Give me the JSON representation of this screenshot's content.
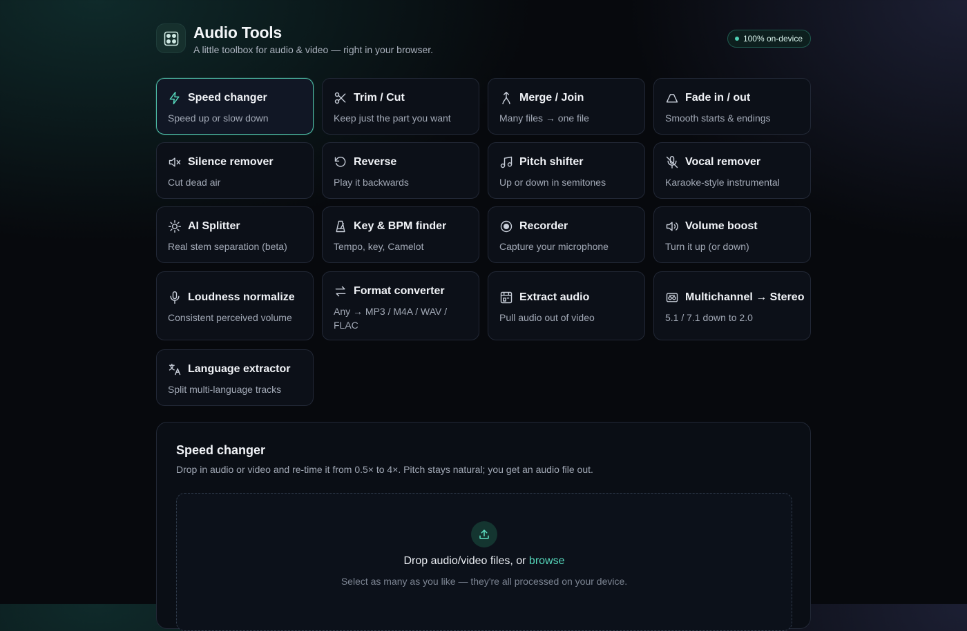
{
  "header": {
    "title": "Audio Tools",
    "subtitle": "A little toolbox for audio & video — right in your browser.",
    "badge": "100% on-device",
    "logo_icon": "mixer-knobs-icon"
  },
  "accent": "#56d6bb",
  "tools": [
    {
      "name": "Speed changer",
      "desc": "Speed up or slow down",
      "icon": "lightning-icon",
      "active": true
    },
    {
      "name": "Trim / Cut",
      "desc": "Keep just the part you want",
      "icon": "scissors-icon"
    },
    {
      "name": "Merge / Join",
      "desc": "Many files → one file",
      "icon": "merge-icon"
    },
    {
      "name": "Fade in / out",
      "desc": "Smooth starts & endings",
      "icon": "fade-trapezoid-icon"
    },
    {
      "name": "Silence remover",
      "desc": "Cut dead air",
      "icon": "speaker-mute-icon"
    },
    {
      "name": "Reverse",
      "desc": "Play it backwards",
      "icon": "rotate-ccw-icon"
    },
    {
      "name": "Pitch shifter",
      "desc": "Up or down in semitones",
      "icon": "music-note-icon"
    },
    {
      "name": "Vocal remover",
      "desc": "Karaoke-style instrumental",
      "icon": "mic-off-icon"
    },
    {
      "name": "AI Splitter",
      "desc": "Real stem separation (beta)",
      "icon": "sparkle-icon"
    },
    {
      "name": "Key & BPM finder",
      "desc": "Tempo, key, Camelot",
      "icon": "metronome-icon"
    },
    {
      "name": "Recorder",
      "desc": "Capture your microphone",
      "icon": "record-icon"
    },
    {
      "name": "Volume boost",
      "desc": "Turn it up (or down)",
      "icon": "volume-icon"
    },
    {
      "name": "Loudness normalize",
      "desc": "Consistent perceived volume",
      "icon": "microphone-icon"
    },
    {
      "name": "Format converter",
      "desc": "Any → MP3 / M4A / WAV / FLAC",
      "icon": "swap-arrows-icon"
    },
    {
      "name": "Extract audio",
      "desc": "Pull audio out of video",
      "icon": "film-icon"
    },
    {
      "name": "Multichannel → Stereo",
      "desc": "5.1 / 7.1 down to 2.0",
      "icon": "boombox-icon"
    },
    {
      "name": "Language extractor",
      "desc": "Split multi-language tracks",
      "icon": "translate-icon"
    }
  ],
  "panel": {
    "title": "Speed changer",
    "desc": "Drop in audio or video and re-time it from 0.5× to 4×. Pitch stays natural; you get an audio file out.",
    "drop_text": "Drop audio/video files, or",
    "browse_label": "browse",
    "drop_hint": "Select as many as you like — they're all processed on your device.",
    "upload_icon": "upload-icon"
  }
}
